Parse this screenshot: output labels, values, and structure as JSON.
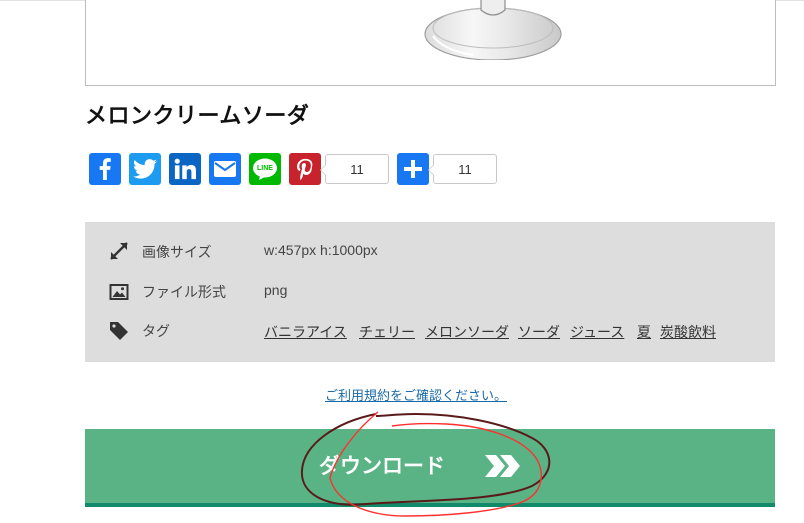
{
  "title": "メロンクリームソーダ",
  "share": {
    "buttons": [
      {
        "name": "facebook",
        "color": "#1877f2"
      },
      {
        "name": "twitter",
        "color": "#1d9bf0"
      },
      {
        "name": "linkedin",
        "color": "#0a66c2"
      },
      {
        "name": "email",
        "color": "#1877f2"
      },
      {
        "name": "line",
        "color": "#00b900",
        "label": "LINE"
      },
      {
        "name": "pinterest",
        "color": "#c8232c"
      },
      {
        "name": "addthis",
        "color": "#1877f2"
      }
    ],
    "pinterest_count": "11",
    "addthis_count": "11"
  },
  "info": {
    "size_label": "画像サイズ",
    "size_value": "w:457px h:1000px",
    "format_label": "ファイル形式",
    "format_value": "png",
    "tags_label": "タグ",
    "tags": [
      "バニラアイス",
      "チェリー",
      "メロンソーダ",
      "ソーダ",
      "ジュース",
      "夏",
      "炭酸飲料"
    ]
  },
  "terms_link": "ご利用規約をご確認ください。",
  "download": {
    "label": "ダウンロード",
    "color": "#59b384",
    "border_color": "#108a6a"
  },
  "annotation_colors": [
    "#5a1a1a",
    "#ff3030"
  ]
}
